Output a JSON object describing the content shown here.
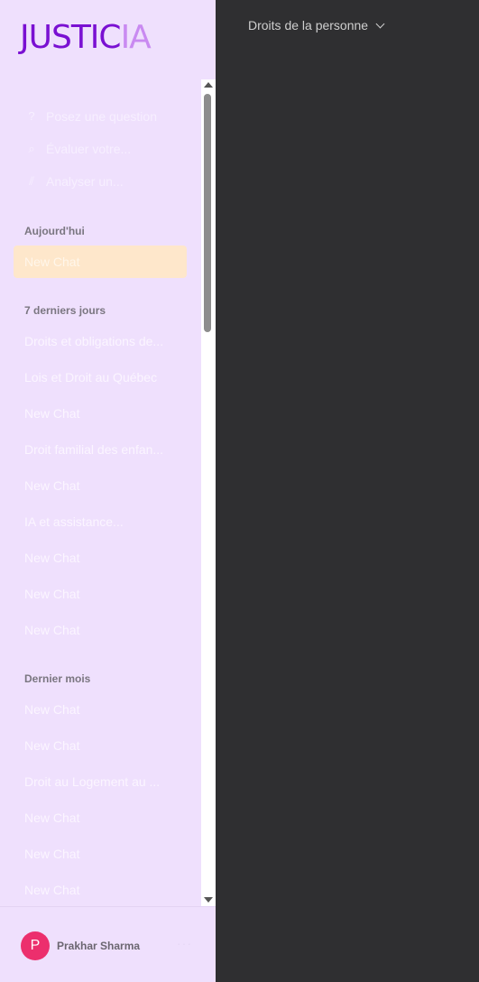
{
  "logo": {
    "part1": "JUSTIC",
    "part2": "IA"
  },
  "header": {
    "topic": "Droits de la personne"
  },
  "actions": [
    {
      "icon": "question-icon",
      "glyph": "?",
      "label": "Posez une question"
    },
    {
      "icon": "search-icon",
      "glyph": "⌕",
      "label": "Évaluer votre..."
    },
    {
      "icon": "analyze-icon",
      "glyph": "⫽",
      "label": "Analyser un..."
    }
  ],
  "sections": {
    "today": "Aujourd'hui",
    "week": "7 derniers jours",
    "month": "Dernier mois"
  },
  "today_items": [
    "New Chat"
  ],
  "week_items": [
    "Droits et obligations de...",
    "Lois et Droit au Québec",
    "New Chat",
    "Droit familial des enfan...",
    "New Chat",
    "IA et assistance...",
    "New Chat",
    "New Chat",
    "New Chat"
  ],
  "month_items": [
    "New Chat",
    "New Chat",
    "Droit au Logement au ...",
    "New Chat",
    "New Chat",
    "New Chat"
  ],
  "user": {
    "initial": "P",
    "name": "Prakhar Sharma",
    "more": "···"
  }
}
